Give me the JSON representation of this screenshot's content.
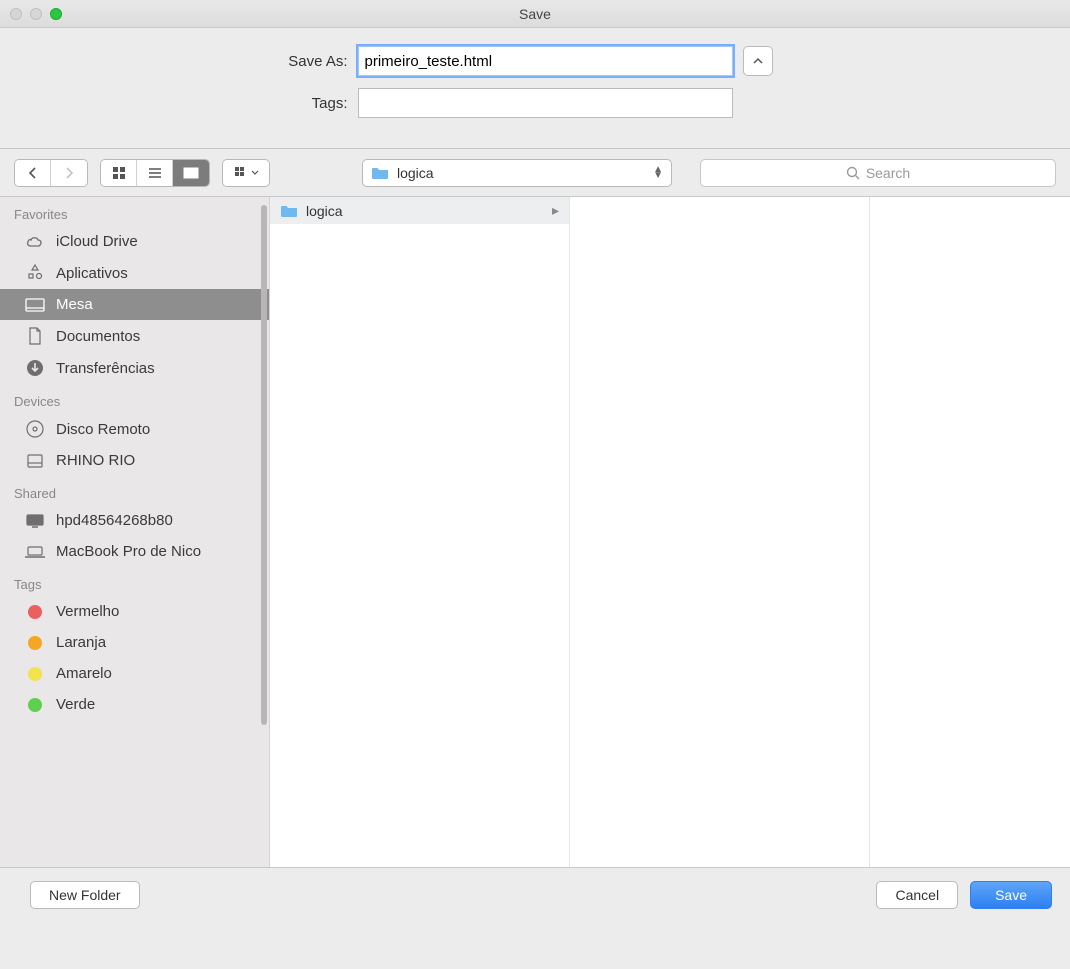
{
  "window": {
    "title": "Save"
  },
  "form": {
    "save_as_label": "Save As:",
    "save_as_value": "primeiro_teste.html",
    "tags_label": "Tags:",
    "tags_value": ""
  },
  "toolbar": {
    "path_selected": "logica",
    "search_placeholder": "Search"
  },
  "sidebar": {
    "sections": {
      "favorites": {
        "header": "Favorites",
        "items": [
          {
            "id": "icloud",
            "label": "iCloud Drive",
            "icon": "cloud"
          },
          {
            "id": "apps",
            "label": "Aplicativos",
            "icon": "apps"
          },
          {
            "id": "desktop",
            "label": "Mesa",
            "icon": "desktop",
            "selected": true
          },
          {
            "id": "documents",
            "label": "Documentos",
            "icon": "doc"
          },
          {
            "id": "downloads",
            "label": "Transferências",
            "icon": "download"
          }
        ]
      },
      "devices": {
        "header": "Devices",
        "items": [
          {
            "id": "remote",
            "label": "Disco Remoto",
            "icon": "disc"
          },
          {
            "id": "rhino",
            "label": "RHINO RIO",
            "icon": "hdd"
          }
        ]
      },
      "shared": {
        "header": "Shared",
        "items": [
          {
            "id": "hpd",
            "label": "hpd48564268b80",
            "icon": "monitor"
          },
          {
            "id": "mbp",
            "label": "MacBook Pro de Nico",
            "icon": "laptop"
          }
        ]
      },
      "tags": {
        "header": "Tags",
        "items": [
          {
            "id": "red",
            "label": "Vermelho",
            "color": "#ec5f5f"
          },
          {
            "id": "orange",
            "label": "Laranja",
            "color": "#f5a623"
          },
          {
            "id": "yellow",
            "label": "Amarelo",
            "color": "#f2e24b"
          },
          {
            "id": "green",
            "label": "Verde",
            "color": "#5fd04e"
          }
        ]
      }
    }
  },
  "columns": {
    "col1": [
      {
        "label": "logica",
        "type": "folder"
      }
    ]
  },
  "footer": {
    "new_folder": "New Folder",
    "cancel": "Cancel",
    "save": "Save"
  }
}
